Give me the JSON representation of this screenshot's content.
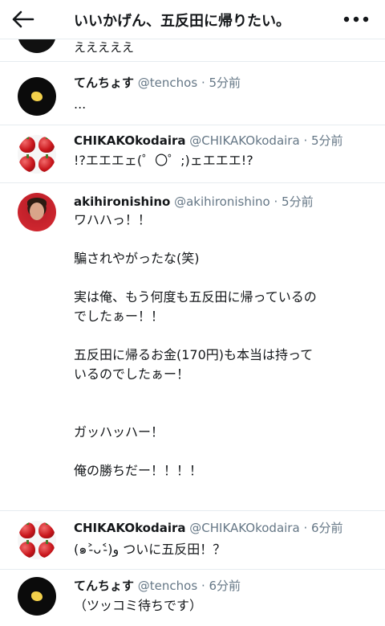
{
  "header": {
    "title": "いいかげん、五反田に帰りたい。"
  },
  "partial_tweet": {
    "text": "えええええ"
  },
  "tweets": [
    {
      "name": "てんちょす",
      "handle": "@tenchos",
      "time": "5分前",
      "lines": [
        "..."
      ]
    },
    {
      "name": "CHIKAKOkodaira",
      "handle": "@CHIKAKOkodaira",
      "time": "5分前",
      "lines": [
        "!?エエエェ(゜〇゜;)ェエエエ!?"
      ]
    },
    {
      "name": "akihironishino",
      "handle": "@akihironishino",
      "time": "5分前",
      "lines": [
        "ワハハっ！！",
        "",
        "騙されやがったな(笑)",
        "",
        "実は俺、もう何度も五反田に帰っているの",
        "でしたぁー！！",
        "",
        "五反田に帰るお金(170円)も本当は持って",
        "いるのでしたぁー！",
        "",
        "",
        "ガッハッハー！",
        "",
        "俺の勝ちだー！！！！"
      ]
    },
    {
      "name": "CHIKAKOkodaira",
      "handle": "@CHIKAKOkodaira",
      "time": "6分前",
      "lines": [
        "(๑˃̵ᴗ˂̵)و ついに五反田！？"
      ]
    },
    {
      "name": "てんちょす",
      "handle": "@tenchos",
      "time": "6分前",
      "lines": [
        "（ツッコミ待ちです）"
      ]
    }
  ],
  "separator": "·",
  "icons": {
    "back": "arrow-left-icon",
    "more": "more-horizontal-icon"
  }
}
